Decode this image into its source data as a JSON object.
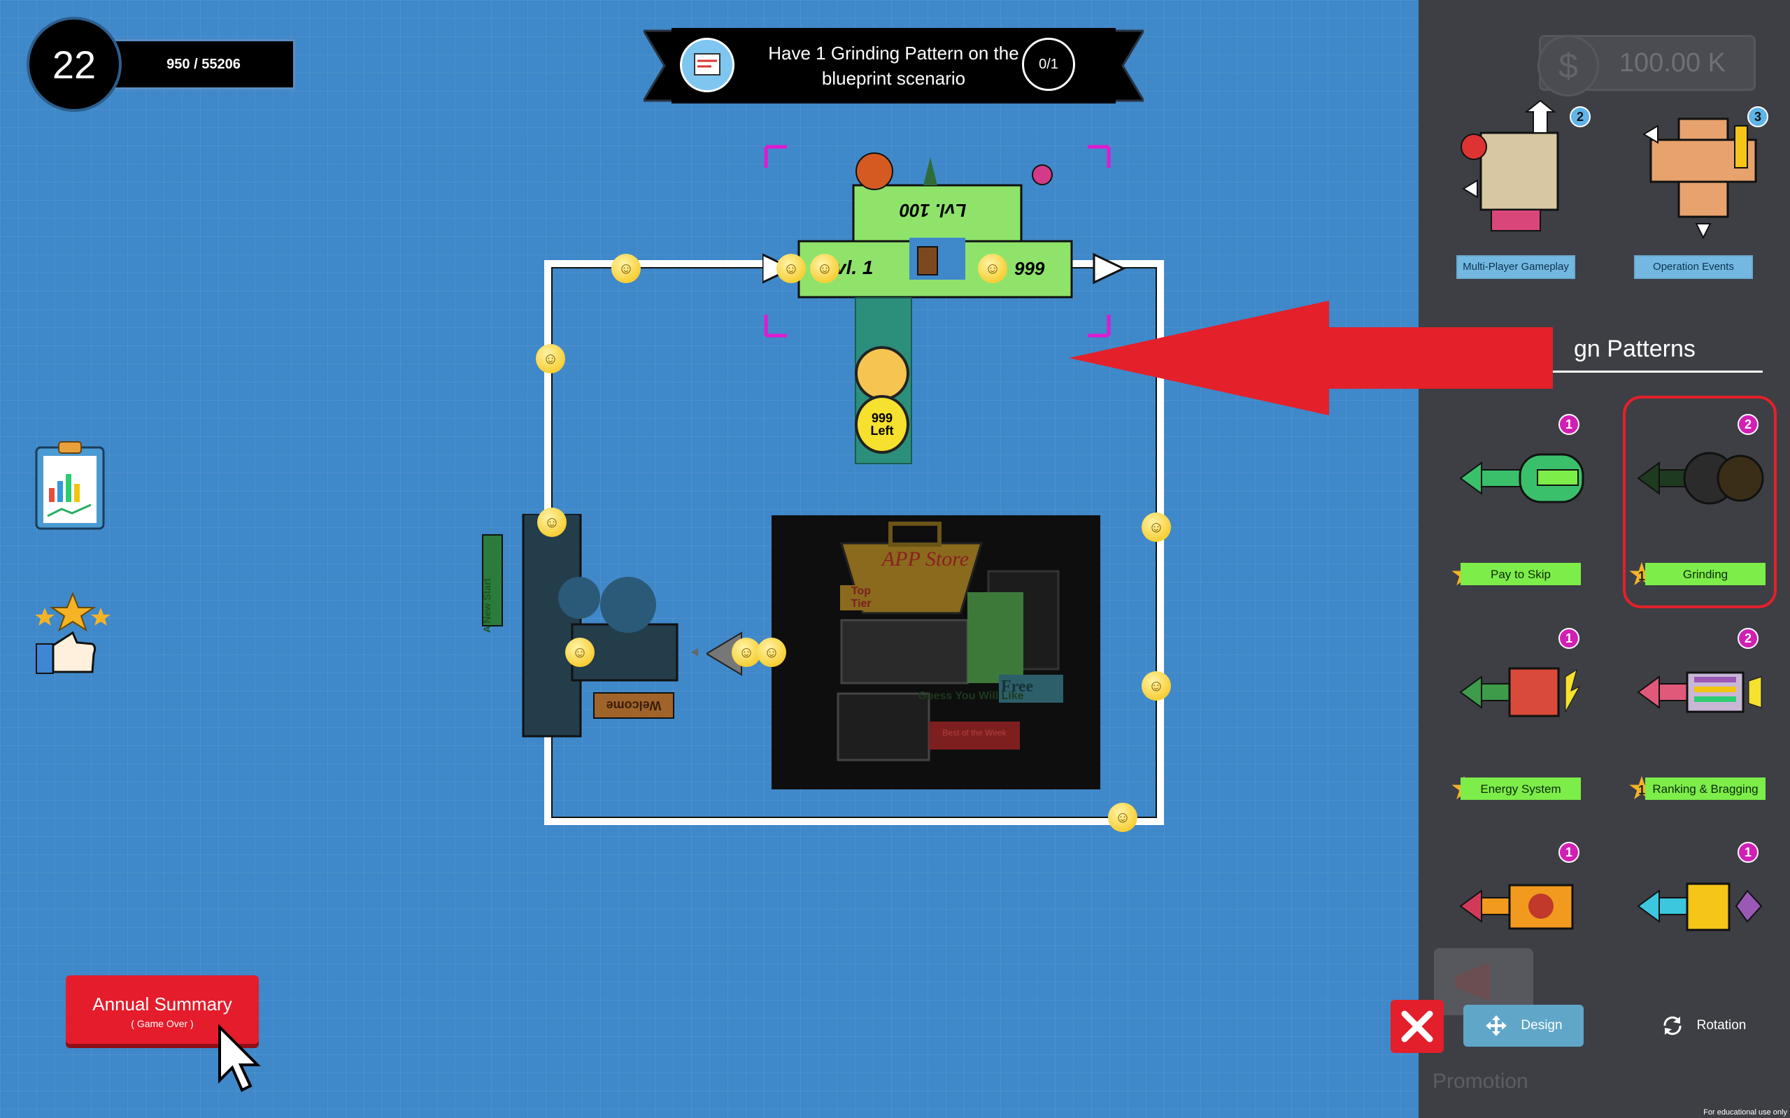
{
  "hud": {
    "level": "22",
    "xp": "950 / 55206"
  },
  "quest": {
    "text": "Have 1 Grinding Pattern on the blueprint scenario",
    "progress": "0/1"
  },
  "board": {
    "lvl_top": "Lvl. 100",
    "lvl_left": "vl. 1",
    "lvl_right": "999",
    "left_counter": "999\nLeft",
    "store_title": "APP Store",
    "store_tier": "Top Tier",
    "store_free": "Free",
    "store_guess": "Guess You Will Like",
    "store_best": "Best of the Week",
    "welcome": "Welcome",
    "new_start": "A New Start"
  },
  "left_tools": {
    "annual_summary": "Annual Summary",
    "annual_sub": "( Game Over )"
  },
  "side": {
    "money": "100.00 K",
    "money_symbol": "$",
    "top_cards": [
      {
        "label": "Multi-Player Gameplay",
        "count": "2"
      },
      {
        "label": "Operation Events",
        "count": "3"
      }
    ],
    "section_title": "gn Patterns",
    "patterns": [
      {
        "label": "Pay to Skip",
        "badge": "1",
        "star": "1",
        "color": "#3ac06b"
      },
      {
        "label": "Grinding",
        "badge": "2",
        "star": "1",
        "color": "#2b2b2b"
      },
      {
        "label": "Energy System",
        "badge": "1",
        "star": "1",
        "color": "#d94a3a"
      },
      {
        "label": "Ranking & Bragging",
        "badge": "2",
        "star": "1",
        "color": "#e0587a"
      },
      {
        "badge": "1",
        "color": "#f29a1e"
      },
      {
        "badge": "1",
        "color": "#3cc7df"
      }
    ],
    "design_btn": "Design",
    "rotation_btn": "Rotation",
    "promotion": "Promotion",
    "edu_note": "For educational use only"
  },
  "colors": {
    "board_bg": "#3f88c9",
    "panel_bg": "#3d3f44",
    "accent_red": "#e41c2b",
    "label_green": "#7ded4a",
    "label_blue": "#73b8e0"
  }
}
